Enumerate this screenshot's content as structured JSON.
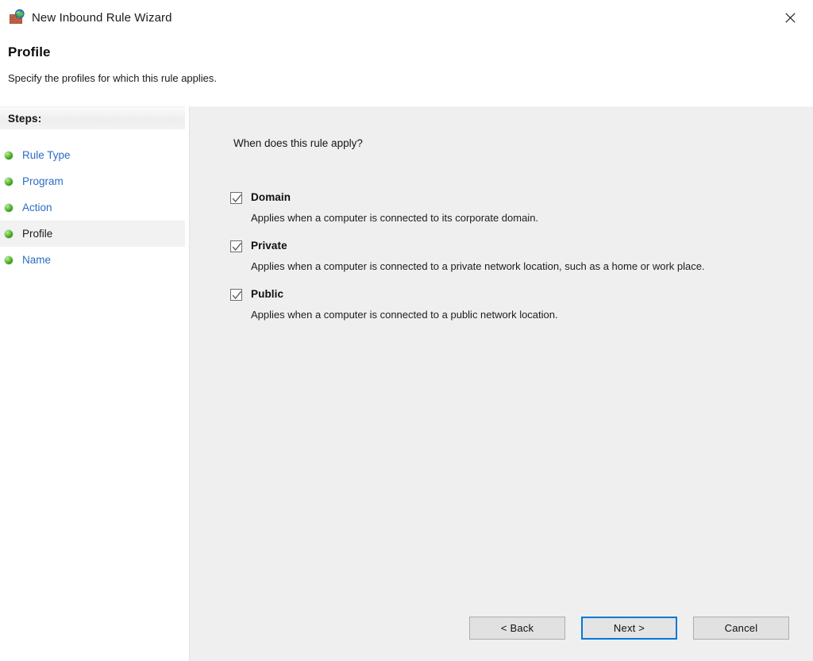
{
  "window": {
    "title": "New Inbound Rule Wizard",
    "icon": "firewall-brick-wall-globe-icon",
    "close_icon": "close-icon"
  },
  "header": {
    "title": "Profile",
    "subtitle": "Specify the profiles for which this rule applies."
  },
  "sidebar": {
    "header_label": "Steps:",
    "items": [
      {
        "label": "Rule Type",
        "icon": "green-bullet-icon",
        "current": false
      },
      {
        "label": "Program",
        "icon": "green-bullet-icon",
        "current": false
      },
      {
        "label": "Action",
        "icon": "green-bullet-icon",
        "current": false
      },
      {
        "label": "Profile",
        "icon": "green-bullet-icon",
        "current": true
      },
      {
        "label": "Name",
        "icon": "green-bullet-icon",
        "current": false
      }
    ]
  },
  "main": {
    "question": "When does this rule apply?",
    "options": [
      {
        "label": "Domain",
        "checked": true,
        "description": "Applies when a computer is connected to its corporate domain."
      },
      {
        "label": "Private",
        "checked": true,
        "description": "Applies when a computer is connected to a private network location, such as a home or work place."
      },
      {
        "label": "Public",
        "checked": true,
        "description": "Applies when a computer is connected to a public network location."
      }
    ]
  },
  "buttons": {
    "back": "< Back",
    "next": "Next >",
    "cancel": "Cancel",
    "focused": "next"
  },
  "colors": {
    "panel_bg": "#efefef",
    "window_bg": "#ffffff",
    "link_blue": "#2b6cc4",
    "focus_blue": "#0078d7",
    "button_face": "#e1e1e1",
    "bullet_green": "#2f9416",
    "highlight_row": "#f2f2f2"
  }
}
